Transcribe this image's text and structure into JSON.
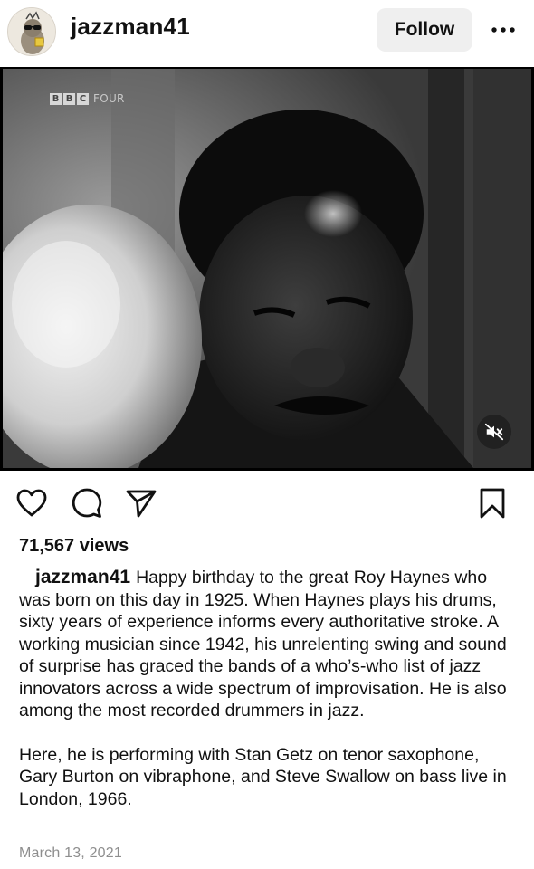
{
  "post": {
    "username": "jazzman41",
    "follow_label": "Follow",
    "more_label": "…"
  },
  "media": {
    "channel_logo": [
      "B",
      "B",
      "C"
    ],
    "channel_suffix": "FOUR"
  },
  "stats": {
    "views": "71,567 views"
  },
  "caption": {
    "author": "jazzman41",
    "paragraph1": "Happy birthday to the great Roy Haynes who was born on this day in 1925. When Haynes plays his drums, sixty years of experience informs every authoritative stroke. A working musician since 1942, his unrelenting swing and sound of surprise has graced the bands of a who’s-who list of jazz innovators across a wide spectrum of improvisation. He is also among the most recorded drummers in jazz.",
    "paragraph2": "Here, he is performing with Stan Getz on tenor saxophone, Gary Burton on vibraphone, and  Steve Swallow on bass live in London, 1966."
  },
  "date": "March 13, 2021",
  "icons": {
    "like": "heart-icon",
    "comment": "comment-icon",
    "share": "send-icon",
    "save": "bookmark-icon",
    "mute": "speaker-muted-icon",
    "more": "more-dots-icon"
  }
}
